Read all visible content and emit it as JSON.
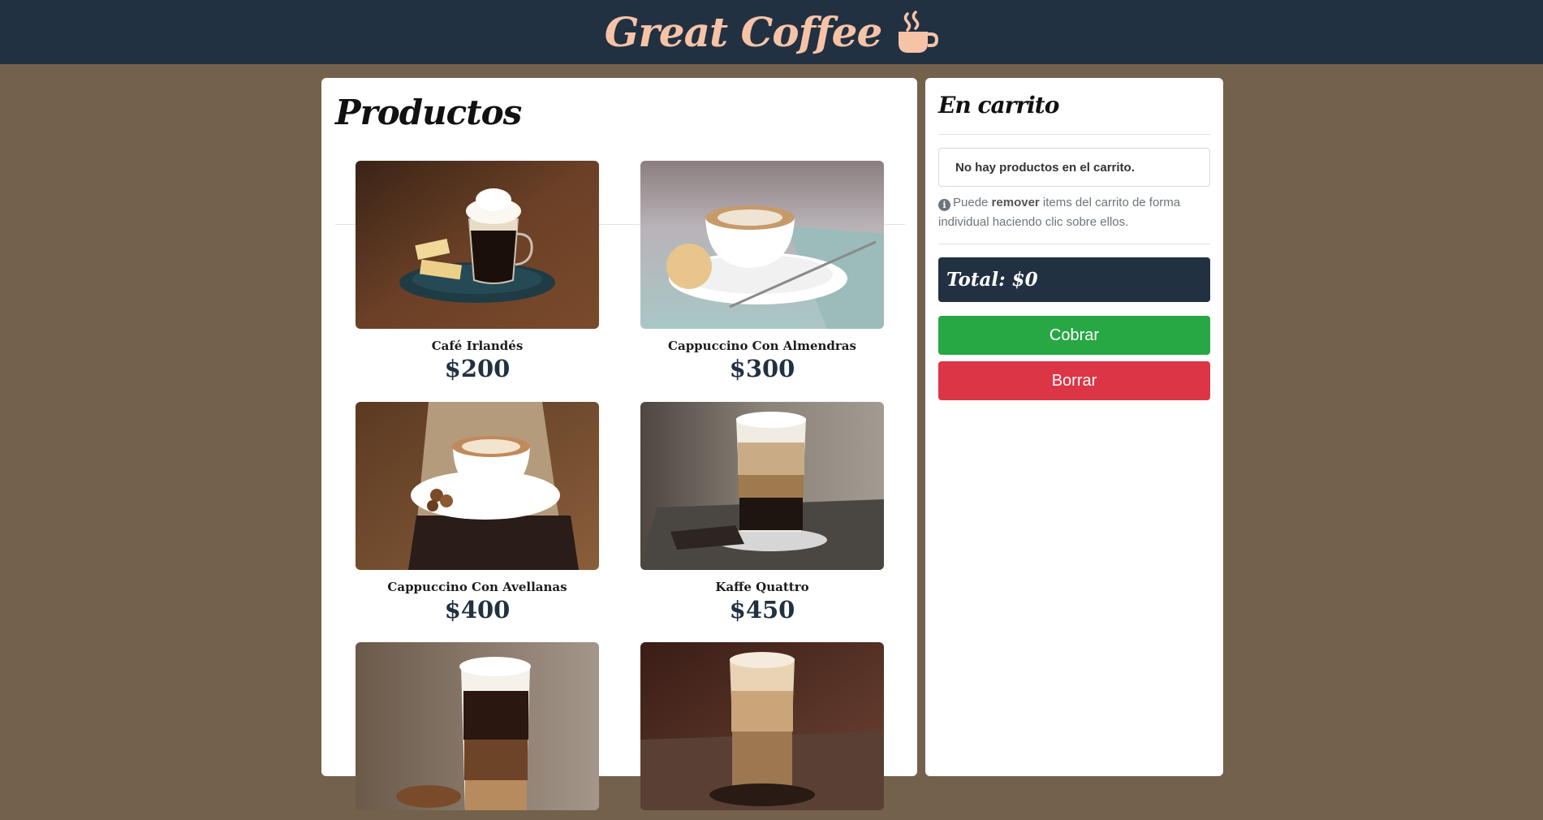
{
  "header": {
    "title": "Great Coffee",
    "icon": "coffee-cup-icon",
    "accent_color": "#f7c3a7",
    "background_color": "#223142"
  },
  "products": {
    "heading": "Productos",
    "items": [
      {
        "name": "Café Irlandés",
        "price": "$200"
      },
      {
        "name": "Cappuccino Con Almendras",
        "price": "$300"
      },
      {
        "name": "Cappuccino Con Avellanas",
        "price": "$400"
      },
      {
        "name": "Kaffe Quattro",
        "price": "$450"
      },
      {
        "name": "",
        "price": ""
      },
      {
        "name": "",
        "price": ""
      }
    ]
  },
  "cart": {
    "heading": "En carrito",
    "empty_message": "No hay productos en el carrito.",
    "hint_prefix": "Puede ",
    "hint_bold": "remover",
    "hint_suffix": " items del carrito de forma individual haciendo clic sobre ellos.",
    "total_label": "Total: $0",
    "checkout_label": "Cobrar",
    "clear_label": "Borrar"
  },
  "colors": {
    "page_background": "#73614b",
    "checkout_button": "#28a745",
    "clear_button": "#dc3545"
  }
}
